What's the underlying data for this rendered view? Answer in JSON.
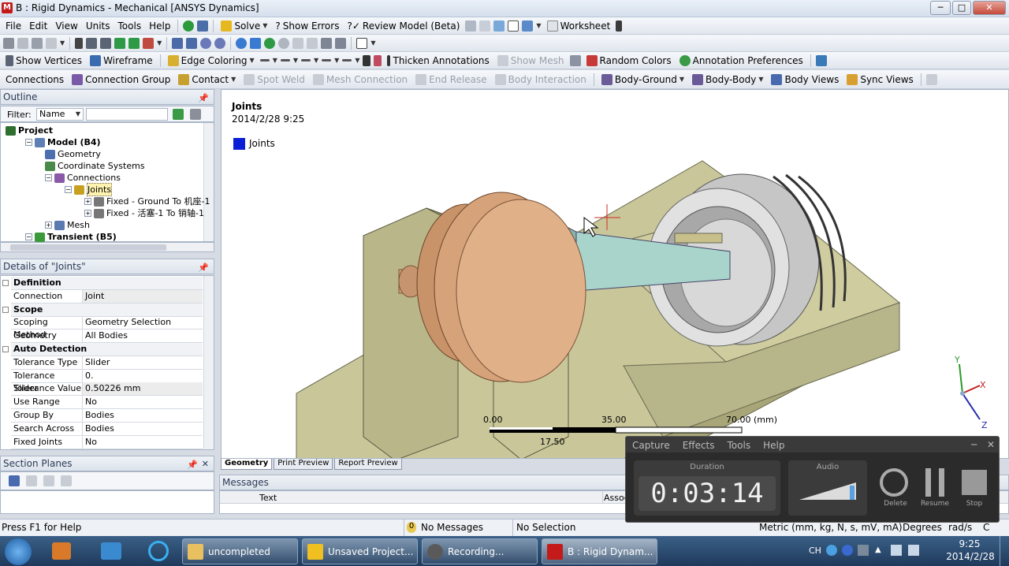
{
  "window": {
    "title": "B : Rigid Dynamics - Mechanical [ANSYS Dynamics]",
    "app_icon_letter": "M",
    "minimize": "─",
    "maximize": "□",
    "close": "✕"
  },
  "menu": [
    "File",
    "Edit",
    "View",
    "Units",
    "Tools",
    "Help"
  ],
  "toolbar1": {
    "solve": "Solve",
    "show_errors": "Show Errors",
    "review_model": "Review Model (Beta)",
    "worksheet": "Worksheet"
  },
  "toolbar2": {
    "show_vertices": "Show Vertices",
    "wireframe": "Wireframe",
    "edge_coloring": "Edge Coloring",
    "thicken_annotations": "Thicken Annotations",
    "show_mesh": "Show Mesh",
    "random_colors": "Random Colors",
    "annotation_preferences": "Annotation Preferences"
  },
  "toolbar3": {
    "connections": "Connections",
    "connection_group": "Connection Group",
    "contact": "Contact",
    "spot_weld": "Spot Weld",
    "mesh_connection": "Mesh Connection",
    "end_release": "End Release",
    "body_interaction": "Body Interaction",
    "body_ground": "Body-Ground",
    "body_body": "Body-Body",
    "body_views": "Body Views",
    "sync_views": "Sync Views"
  },
  "outline": {
    "title": "Outline",
    "filter_label": "Filter:",
    "filter_value": "Name",
    "tree": [
      {
        "label": "Project",
        "bold": true,
        "indent": 0,
        "color": "#2f6f2f"
      },
      {
        "label": "Model (B4)",
        "bold": true,
        "indent": 1,
        "color": "#5d7fb5"
      },
      {
        "label": "Geometry",
        "bold": false,
        "indent": 2,
        "color": "#4c6fb0"
      },
      {
        "label": "Coordinate Systems",
        "bold": false,
        "indent": 2,
        "color": "#4a8a4a"
      },
      {
        "label": "Connections",
        "bold": false,
        "indent": 2,
        "color": "#8a5aa8"
      },
      {
        "label": "Joints",
        "bold": false,
        "indent": 3,
        "color": "#c8a020"
      },
      {
        "label": "Fixed - Ground To 机座-1",
        "bold": false,
        "indent": 4,
        "color": "#777777"
      },
      {
        "label": "Fixed - 活塞-1 To 销轴-1",
        "bold": false,
        "indent": 4,
        "color": "#777777"
      },
      {
        "label": "Mesh",
        "bold": false,
        "indent": 2,
        "color": "#5a7ab0"
      },
      {
        "label": "Transient (B5)",
        "bold": true,
        "indent": 1,
        "color": "#3a9a3a"
      }
    ]
  },
  "details": {
    "title": "Details of \"Joints\"",
    "rows": [
      {
        "type": "section",
        "label": "Definition"
      },
      {
        "type": "row",
        "key": "Connection Type",
        "value": "Joint"
      },
      {
        "type": "section",
        "label": "Scope"
      },
      {
        "type": "row",
        "key": "Scoping Method",
        "value": "Geometry Selection"
      },
      {
        "type": "row",
        "key": "Geometry",
        "value": "All Bodies"
      },
      {
        "type": "section",
        "label": "Auto Detection"
      },
      {
        "type": "row",
        "key": "Tolerance Type",
        "value": "Slider"
      },
      {
        "type": "row",
        "key": "Tolerance Slider",
        "value": "0."
      },
      {
        "type": "row",
        "key": "Tolerance Value",
        "value": "0.50226 mm"
      },
      {
        "type": "row",
        "key": "Use Range",
        "value": "No"
      },
      {
        "type": "row",
        "key": "Group By",
        "value": "Bodies"
      },
      {
        "type": "row",
        "key": "Search Across",
        "value": "Bodies"
      },
      {
        "type": "row",
        "key": "Fixed Joints",
        "value": "No"
      }
    ]
  },
  "section_planes": {
    "title": "Section Planes"
  },
  "viewport": {
    "heading": "Joints",
    "date": "2014/2/28 9:25",
    "legend_label": "Joints",
    "legend_color": "#0a1fd6",
    "scale_labels": [
      "0.00",
      "35.00",
      "70.00 (mm)"
    ],
    "scale_mid": "17.50",
    "axis_x": "X",
    "axis_y": "Y",
    "axis_z": "Z"
  },
  "bottom_tabs": [
    "Geometry",
    "Print Preview",
    "Report Preview"
  ],
  "messages": {
    "title": "Messages",
    "col_text": "Text",
    "col_association": "Association"
  },
  "status": {
    "help": "Press F1 for Help",
    "messages_count": "0",
    "messages": "No Messages",
    "selection": "No Selection",
    "units": "Metric (mm, kg, N, s, mV, mA)",
    "angle": "Degrees",
    "rate": "rad/s",
    "temp": "C"
  },
  "recorder": {
    "menu": [
      "Capture",
      "Effects",
      "Tools",
      "Help"
    ],
    "duration_label": "Duration",
    "duration": "0:03:14",
    "audio_label": "Audio",
    "delete": "Delete",
    "resume": "Resume",
    "stop": "Stop"
  },
  "taskbar": {
    "items": [
      "uncompleted",
      "Unsaved Project...",
      "Recording...",
      "B : Rigid Dynam..."
    ],
    "lang": "CH",
    "time": "9:25",
    "date": "2014/2/28"
  }
}
